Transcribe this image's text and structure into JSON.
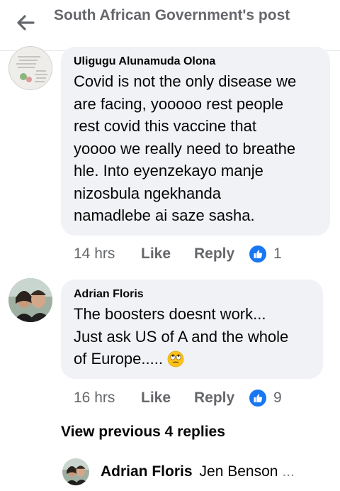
{
  "header": {
    "title": "South African Government's post"
  },
  "comments": [
    {
      "author": "Uligugu Alunamuda Olona",
      "lines": [
        "Covid is not the only disease we",
        "are facing, yooooo rest people",
        "rest covid this vaccine that",
        "yoooo we really need to breathe",
        "hle. Into eyenzekayo manje",
        "nizosbula ngekhanda",
        "namadlebe ai saze sasha."
      ],
      "time": "14 hrs",
      "like_label": "Like",
      "reply_label": "Reply",
      "reaction_count": "1"
    },
    {
      "author": "Adrian Floris",
      "lines": [
        "The boosters doesnt work...",
        "Just ask US of A and the whole",
        "of Europe....."
      ],
      "emoji": "🙄",
      "time": "16 hrs",
      "like_label": "Like",
      "reply_label": "Reply",
      "reaction_count": "9"
    }
  ],
  "view_previous": "View previous 4 replies",
  "latest_reply": {
    "author": "Adrian Floris",
    "snippet": "Jen Benson",
    "ellipsis": "..."
  },
  "colors": {
    "bubble": "#f0f2f5",
    "like_blue": "#1877f2",
    "meta_gray": "#65676b"
  }
}
